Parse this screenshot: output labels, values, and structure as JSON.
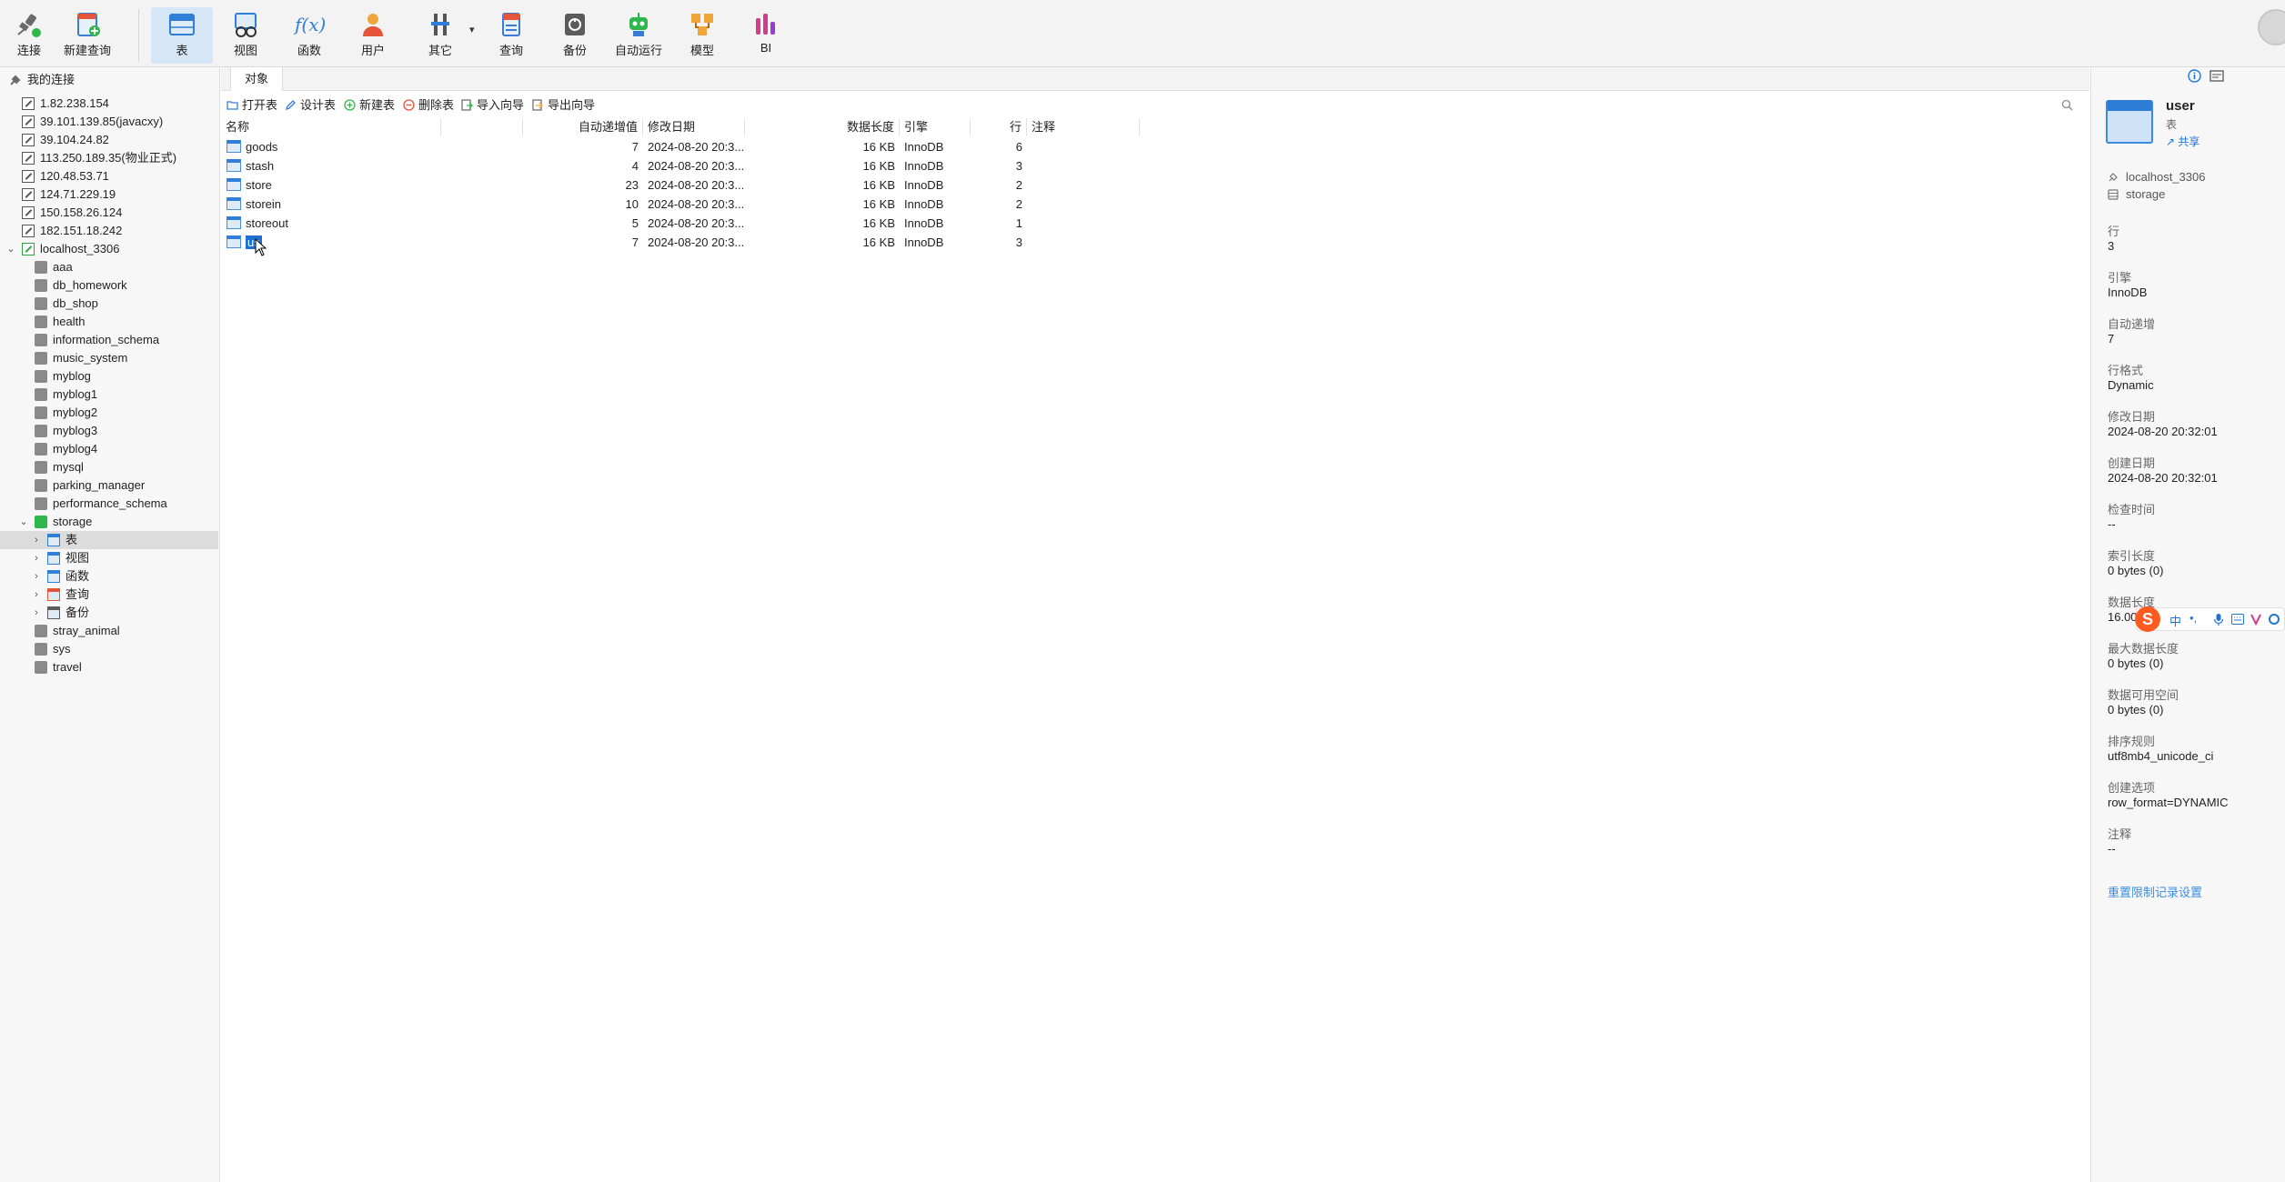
{
  "toolbar": {
    "items": [
      {
        "label": "连接",
        "icon": "plug-icon"
      },
      {
        "label": "新建查询",
        "icon": "new-query-icon"
      },
      {
        "label": "表",
        "icon": "table-icon"
      },
      {
        "label": "视图",
        "icon": "view-icon"
      },
      {
        "label": "函数",
        "icon": "function-icon"
      },
      {
        "label": "用户",
        "icon": "user-icon"
      },
      {
        "label": "其它",
        "icon": "tools-icon"
      },
      {
        "label": "查询",
        "icon": "query-icon"
      },
      {
        "label": "备份",
        "icon": "backup-icon"
      },
      {
        "label": "自动运行",
        "icon": "robot-icon"
      },
      {
        "label": "模型",
        "icon": "model-icon"
      },
      {
        "label": "BI",
        "icon": "bi-icon"
      }
    ],
    "function_glyph": "f(x)",
    "dropdown_glyph": "▾"
  },
  "sidebar": {
    "header": "我的连接",
    "connections": [
      "1.82.238.154",
      "39.101.139.85(javacxy)",
      "39.104.24.82",
      "113.250.189.35(物业正式)",
      "120.48.53.71",
      "124.71.229.19",
      "150.158.26.124",
      "182.151.18.242"
    ],
    "active_connection": "localhost_3306",
    "databases_before": [
      "aaa",
      "db_homework",
      "db_shop",
      "health",
      "information_schema",
      "music_system",
      "myblog",
      "myblog1",
      "myblog2",
      "myblog3",
      "myblog4",
      "mysql",
      "parking_manager",
      "performance_schema"
    ],
    "open_database": "storage",
    "storage_children": [
      "表",
      "视图",
      "函数",
      "查询",
      "备份"
    ],
    "databases_after": [
      "stray_animal",
      "sys",
      "travel"
    ]
  },
  "tabs": {
    "objects": "对象"
  },
  "object_toolbar": {
    "open": "打开表",
    "design": "设计表",
    "new": "新建表",
    "delete": "删除表",
    "import": "导入向导",
    "export": "导出向导"
  },
  "table": {
    "headers": {
      "name": "名称",
      "auto_inc": "自动递增值",
      "modified": "修改日期",
      "data_length": "数据长度",
      "engine": "引擎",
      "rows": "行",
      "comment": "注释"
    },
    "rows": [
      {
        "name": "goods",
        "auto_inc": "7",
        "modified": "2024-08-20 20:3...",
        "data_length": "16 KB",
        "engine": "InnoDB",
        "rows": "6"
      },
      {
        "name": "stash",
        "auto_inc": "4",
        "modified": "2024-08-20 20:3...",
        "data_length": "16 KB",
        "engine": "InnoDB",
        "rows": "3"
      },
      {
        "name": "store",
        "auto_inc": "23",
        "modified": "2024-08-20 20:3...",
        "data_length": "16 KB",
        "engine": "InnoDB",
        "rows": "2"
      },
      {
        "name": "storein",
        "auto_inc": "10",
        "modified": "2024-08-20 20:3...",
        "data_length": "16 KB",
        "engine": "InnoDB",
        "rows": "2"
      },
      {
        "name": "storeout",
        "auto_inc": "5",
        "modified": "2024-08-20 20:3...",
        "data_length": "16 KB",
        "engine": "InnoDB",
        "rows": "1"
      },
      {
        "name": "us",
        "auto_inc": "7",
        "modified": "2024-08-20 20:3...",
        "data_length": "16 KB",
        "engine": "InnoDB",
        "rows": "3"
      }
    ]
  },
  "info": {
    "title": "user",
    "type": "表",
    "share": "共享",
    "connection": "localhost_3306",
    "database": "storage",
    "fields": [
      {
        "label": "行",
        "value": "3"
      },
      {
        "label": "引擎",
        "value": "InnoDB"
      },
      {
        "label": "自动递增",
        "value": "7"
      },
      {
        "label": "行格式",
        "value": "Dynamic"
      },
      {
        "label": "修改日期",
        "value": "2024-08-20 20:32:01"
      },
      {
        "label": "创建日期",
        "value": "2024-08-20 20:32:01"
      },
      {
        "label": "检查时间",
        "value": "--"
      },
      {
        "label": "索引长度",
        "value": "0 bytes (0)"
      },
      {
        "label": "数据长度",
        "value": "16.00"
      },
      {
        "label": "最大数据长度",
        "value": "0 bytes (0)"
      },
      {
        "label": "数据可用空间",
        "value": "0 bytes (0)"
      },
      {
        "label": "排序规则",
        "value": "utf8mb4_unicode_ci"
      },
      {
        "label": "创建选项",
        "value": "row_format=DYNAMIC"
      },
      {
        "label": "注释",
        "value": "--"
      }
    ],
    "reset_link": "重置限制记录设置"
  },
  "ime": {
    "lang": "中",
    "punct": "•,"
  }
}
